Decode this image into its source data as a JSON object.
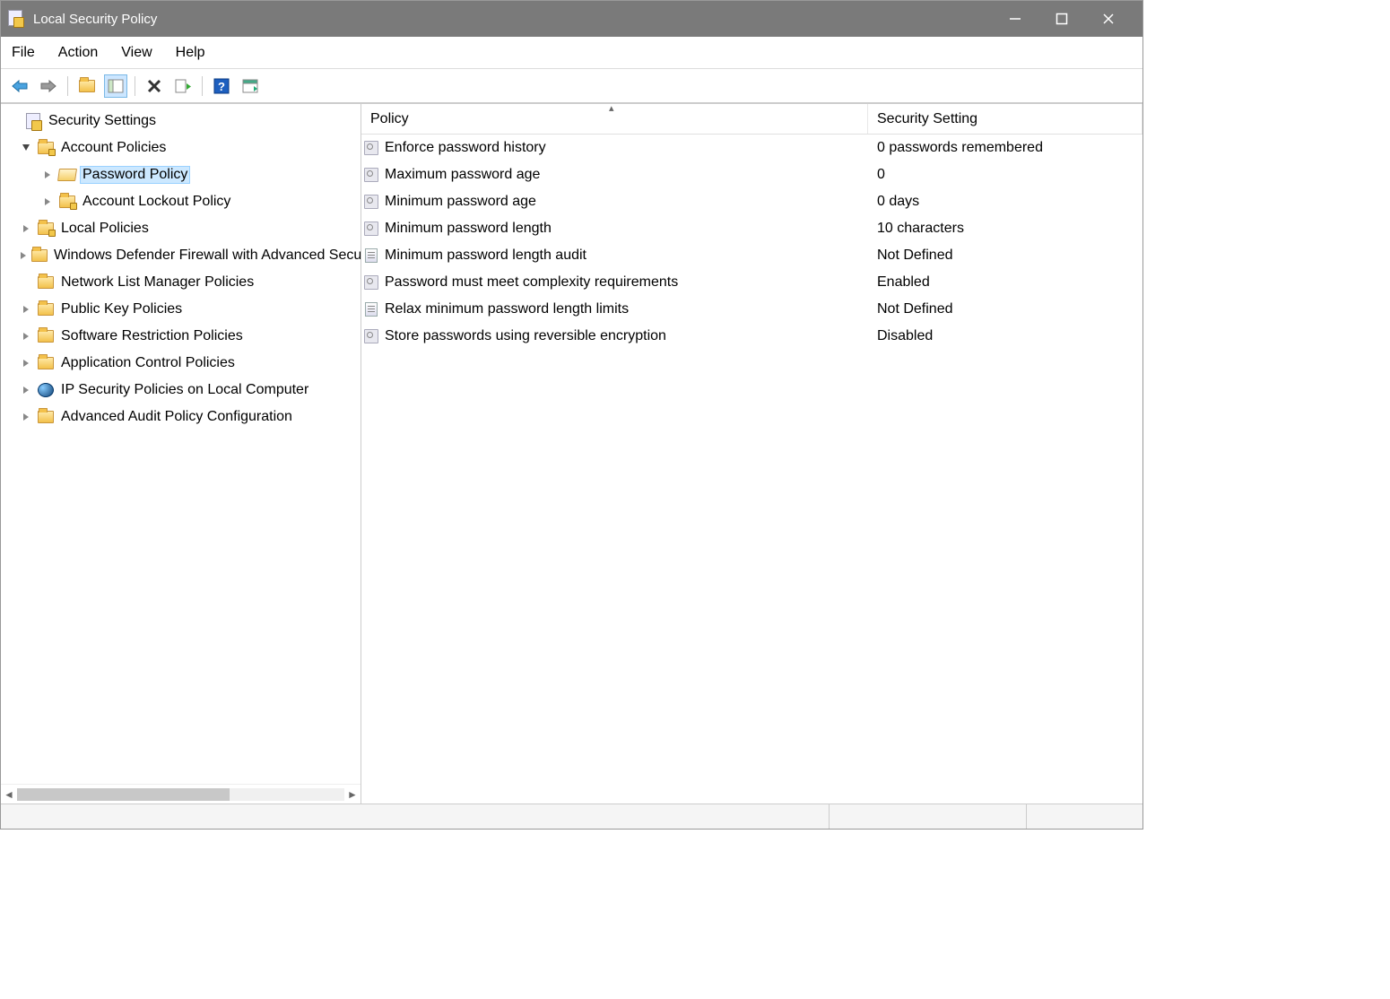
{
  "window": {
    "title": "Local Security Policy"
  },
  "menu": {
    "file": "File",
    "action": "Action",
    "view": "View",
    "help": "Help"
  },
  "tree": {
    "root": "Security Settings",
    "account_policies": "Account Policies",
    "password_policy": "Password Policy",
    "account_lockout_policy": "Account Lockout Policy",
    "local_policies": "Local Policies",
    "windows_defender_firewall": "Windows Defender Firewall with Advanced Security",
    "network_list_manager": "Network List Manager Policies",
    "public_key_policies": "Public Key Policies",
    "software_restriction": "Software Restriction Policies",
    "application_control": "Application Control Policies",
    "ip_security": "IP Security Policies on Local Computer",
    "advanced_audit": "Advanced Audit Policy Configuration"
  },
  "columns": {
    "policy": "Policy",
    "setting": "Security Setting"
  },
  "policies": [
    {
      "name": "Enforce password history",
      "value": "0 passwords remembered",
      "icon": "a"
    },
    {
      "name": "Maximum password age",
      "value": "0",
      "icon": "a"
    },
    {
      "name": "Minimum password age",
      "value": "0 days",
      "icon": "a"
    },
    {
      "name": "Minimum password length",
      "value": "10 characters",
      "icon": "a"
    },
    {
      "name": "Minimum password length audit",
      "value": "Not Defined",
      "icon": "b"
    },
    {
      "name": "Password must meet complexity requirements",
      "value": "Enabled",
      "icon": "a"
    },
    {
      "name": "Relax minimum password length limits",
      "value": "Not Defined",
      "icon": "b"
    },
    {
      "name": "Store passwords using reversible encryption",
      "value": "Disabled",
      "icon": "a"
    }
  ]
}
